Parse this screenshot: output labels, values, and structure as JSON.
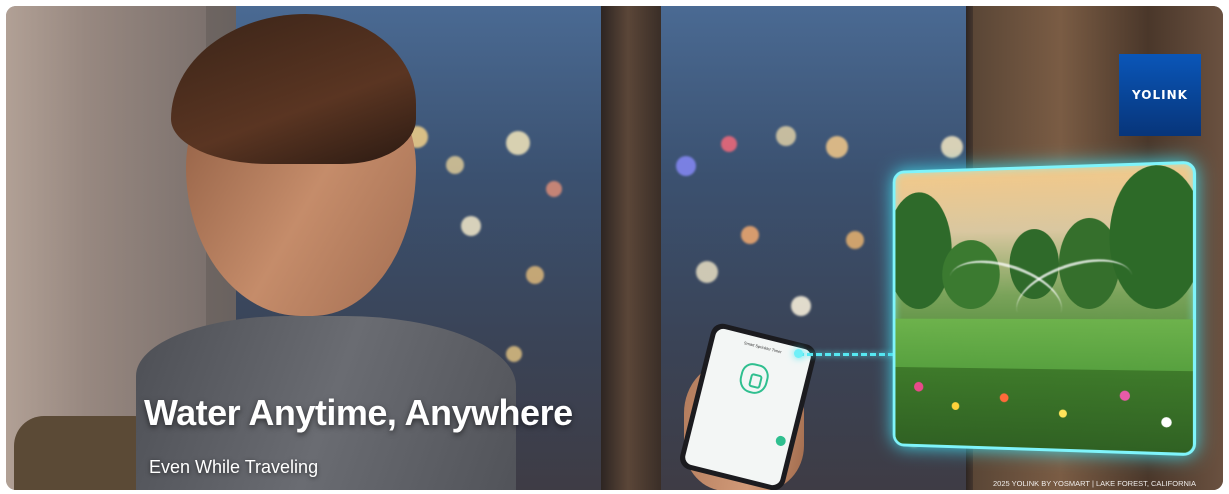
{
  "banner": {
    "headline": "Water Anytime, Anywhere",
    "subheadline": "Even While Traveling",
    "copyright": "2025 YOLINK BY YOSMART | LAKE FOREST, CALIFORNIA",
    "logo_text": "YOLINK",
    "colors": {
      "logo_blue": "#0a56b8",
      "glow_cyan": "#56e8f2",
      "app_green": "#2fbf8f"
    }
  },
  "phone": {
    "app_title": "Smart Sprinkler Timer",
    "icon": "sprinkler-icon"
  },
  "icons": {
    "sprinkler": "sprinkler-icon"
  }
}
